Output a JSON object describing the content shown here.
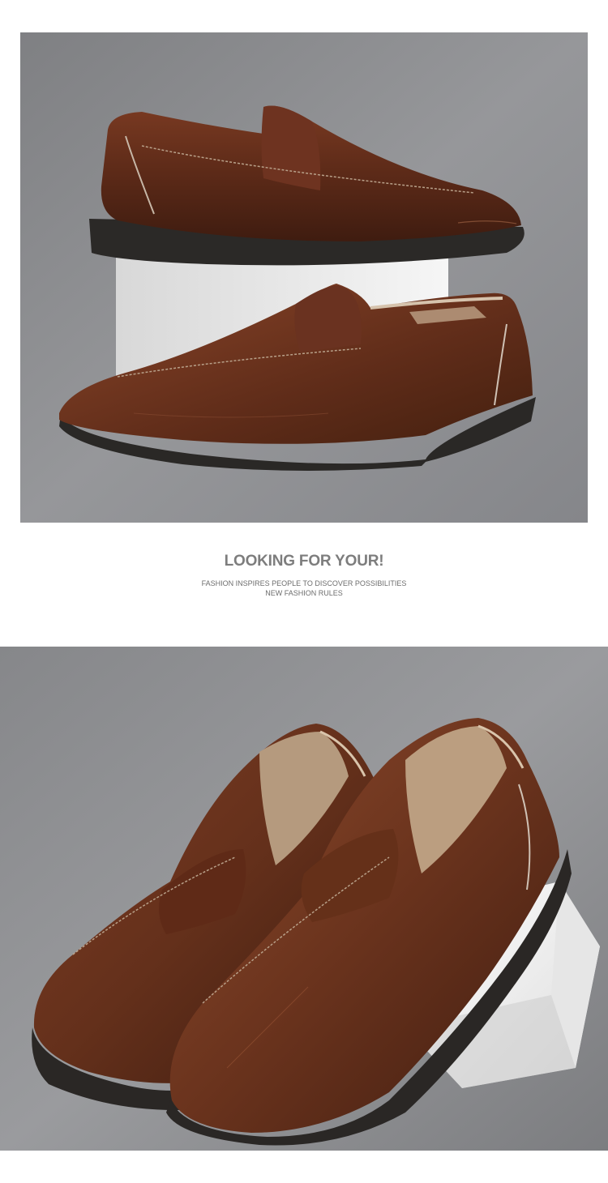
{
  "images": {
    "top": {
      "subject": "brown leather penny loafers side view on white block",
      "background": "#8e8e90"
    },
    "bottom": {
      "subject": "pair of brown leather penny loafers front three-quarter view on white block",
      "background": "#8a8b8d"
    }
  },
  "text": {
    "headline": "LOOKING FOR YOUR!",
    "line1": "FASHION INSPIRES PEOPLE TO DISCOVER POSSIBILITIES",
    "line2": "NEW FASHION RULES"
  },
  "colors": {
    "leather": "#6b3220",
    "sole": "#2a2826",
    "block": "#f2f2f2",
    "text": "#7d7d7d"
  }
}
